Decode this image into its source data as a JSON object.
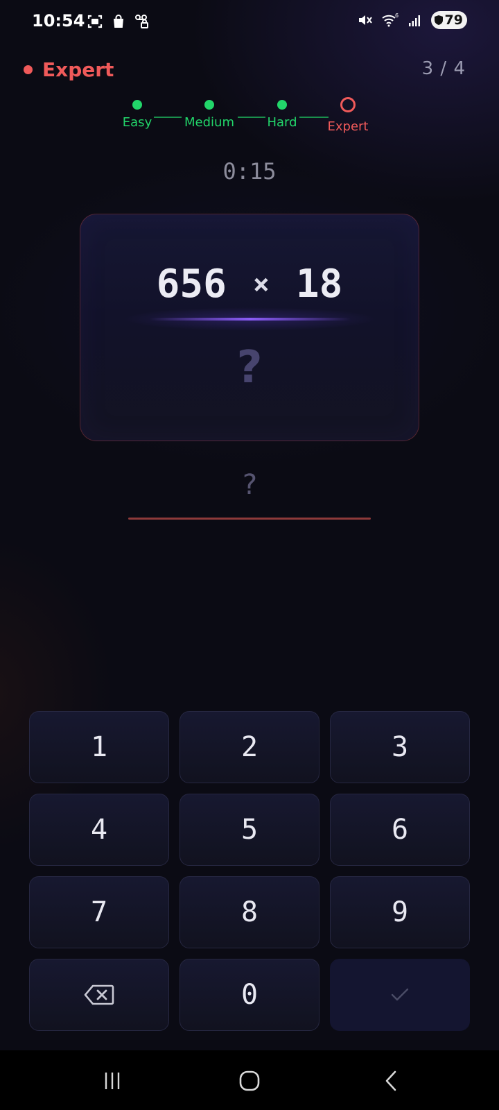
{
  "status_bar": {
    "time": "10:54",
    "battery": "79",
    "left_icons": [
      "screenshot-icon",
      "shopping-bag-icon",
      "voicemail-lock-icon"
    ],
    "right_icons": [
      "mute-icon",
      "wifi-6-icon",
      "signal-icon",
      "battery-icon"
    ]
  },
  "header": {
    "level": "Expert",
    "progress": "3 / 4"
  },
  "stepper": {
    "steps": [
      {
        "label": "Easy",
        "state": "completed"
      },
      {
        "label": "Medium",
        "state": "completed"
      },
      {
        "label": "Hard",
        "state": "completed"
      },
      {
        "label": "Expert",
        "state": "current"
      }
    ]
  },
  "timer": "0:15",
  "problem": {
    "operand1": "656",
    "operator": "×",
    "operand2": "18",
    "placeholder": "?"
  },
  "answer": {
    "value": "?"
  },
  "keypad": {
    "keys": [
      "1",
      "2",
      "3",
      "4",
      "5",
      "6",
      "7",
      "8",
      "9"
    ],
    "zero": "0",
    "backspace_icon": "backspace-icon",
    "confirm_icon": "checkmark-icon"
  },
  "colors": {
    "accent_red": "#f05a5a",
    "complete_green": "#22d66a",
    "glow_purple": "#8b5cf6",
    "background": "#0b0b14"
  }
}
